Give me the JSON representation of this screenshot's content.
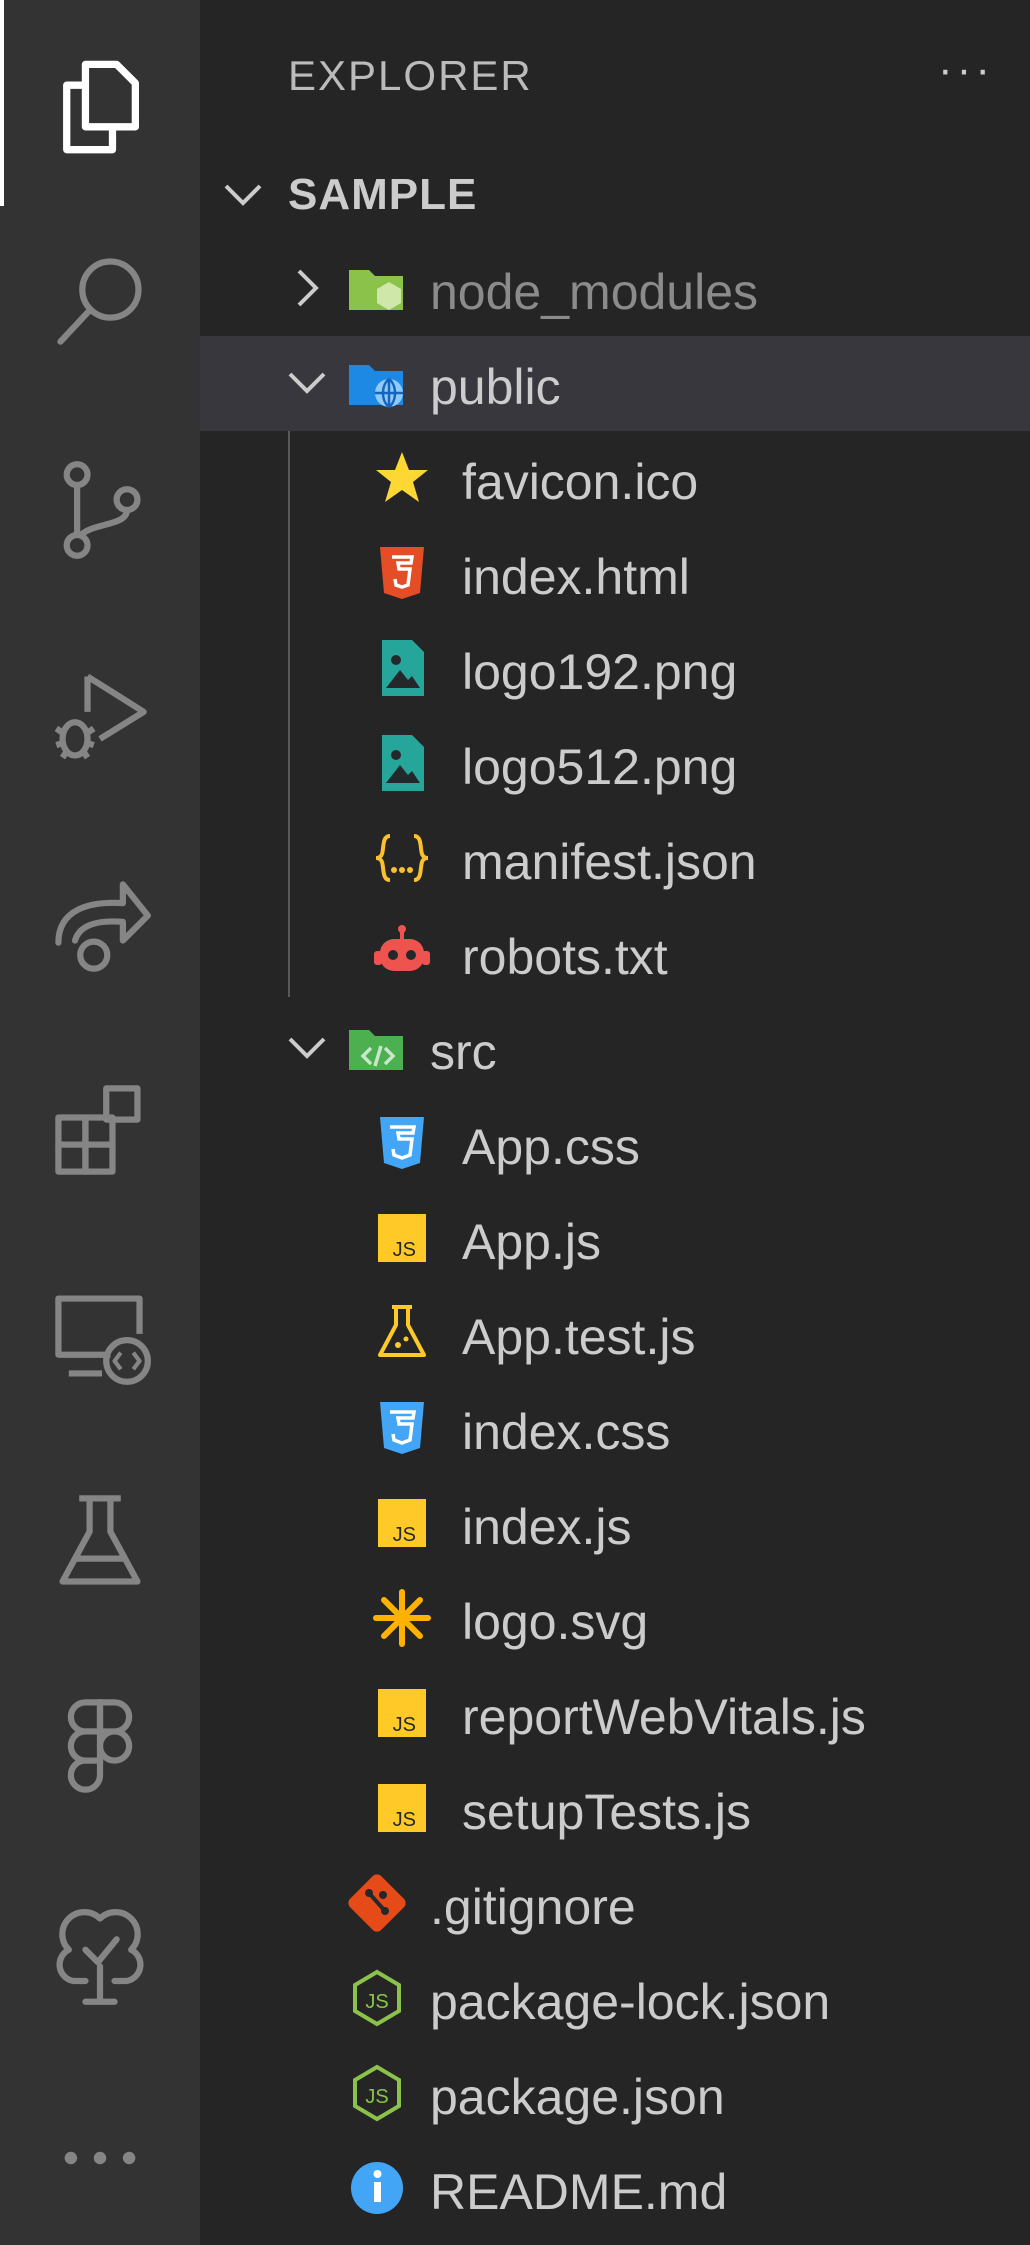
{
  "sidebar": {
    "title": "EXPLORER",
    "more_actions": "···",
    "section": "SAMPLE"
  },
  "tree": [
    {
      "label": "node_modules",
      "kind": "folder",
      "icon": "node-folder-icon",
      "expanded": false,
      "color": "#8bc34a"
    },
    {
      "label": "public",
      "kind": "folder",
      "icon": "public-folder-icon",
      "expanded": true,
      "selected": true,
      "color": "#1e88e5"
    },
    {
      "label": "favicon.ico",
      "kind": "file",
      "icon": "star-icon",
      "color": "#fdd835"
    },
    {
      "label": "index.html",
      "kind": "file",
      "icon": "html5-icon",
      "color": "#e44d26"
    },
    {
      "label": "logo192.png",
      "kind": "file",
      "icon": "image-icon",
      "color": "#26a69a"
    },
    {
      "label": "logo512.png",
      "kind": "file",
      "icon": "image-icon",
      "color": "#26a69a"
    },
    {
      "label": "manifest.json",
      "kind": "file",
      "icon": "json-braces-icon",
      "color": "#fbc02d"
    },
    {
      "label": "robots.txt",
      "kind": "file",
      "icon": "robot-icon",
      "color": "#ef5350"
    },
    {
      "label": "src",
      "kind": "folder",
      "icon": "src-folder-icon",
      "expanded": true,
      "color": "#4caf50"
    },
    {
      "label": "App.css",
      "kind": "file",
      "icon": "css3-icon",
      "color": "#42a5f5"
    },
    {
      "label": "App.js",
      "kind": "file",
      "icon": "javascript-icon",
      "color": "#ffca28"
    },
    {
      "label": "App.test.js",
      "kind": "file",
      "icon": "test-flask-icon",
      "color": "#ffca28"
    },
    {
      "label": "index.css",
      "kind": "file",
      "icon": "css3-icon",
      "color": "#42a5f5"
    },
    {
      "label": "index.js",
      "kind": "file",
      "icon": "javascript-icon",
      "color": "#ffca28"
    },
    {
      "label": "logo.svg",
      "kind": "file",
      "icon": "svg-asterisk-icon",
      "color": "#ffb300"
    },
    {
      "label": "reportWebVitals.js",
      "kind": "file",
      "icon": "javascript-icon",
      "color": "#ffca28"
    },
    {
      "label": "setupTests.js",
      "kind": "file",
      "icon": "javascript-icon",
      "color": "#ffca28"
    },
    {
      "label": ".gitignore",
      "kind": "file",
      "icon": "git-icon",
      "color": "#e64a19"
    },
    {
      "label": "package-lock.json",
      "kind": "file",
      "icon": "nodejs-icon",
      "color": "#8bc34a"
    },
    {
      "label": "package.json",
      "kind": "file",
      "icon": "nodejs-icon",
      "color": "#8bc34a"
    },
    {
      "label": "README.md",
      "kind": "file",
      "icon": "info-icon",
      "color": "#42a5f5"
    }
  ],
  "activity_bar": [
    {
      "name": "explorer-icon",
      "active": true
    },
    {
      "name": "search-icon"
    },
    {
      "name": "source-control-icon"
    },
    {
      "name": "run-debug-icon"
    },
    {
      "name": "remote-share-icon"
    },
    {
      "name": "extensions-icon"
    },
    {
      "name": "remote-explorer-icon"
    },
    {
      "name": "testing-flask-icon"
    },
    {
      "name": "figma-icon"
    },
    {
      "name": "tree-check-icon"
    },
    {
      "name": "more-icon"
    }
  ]
}
